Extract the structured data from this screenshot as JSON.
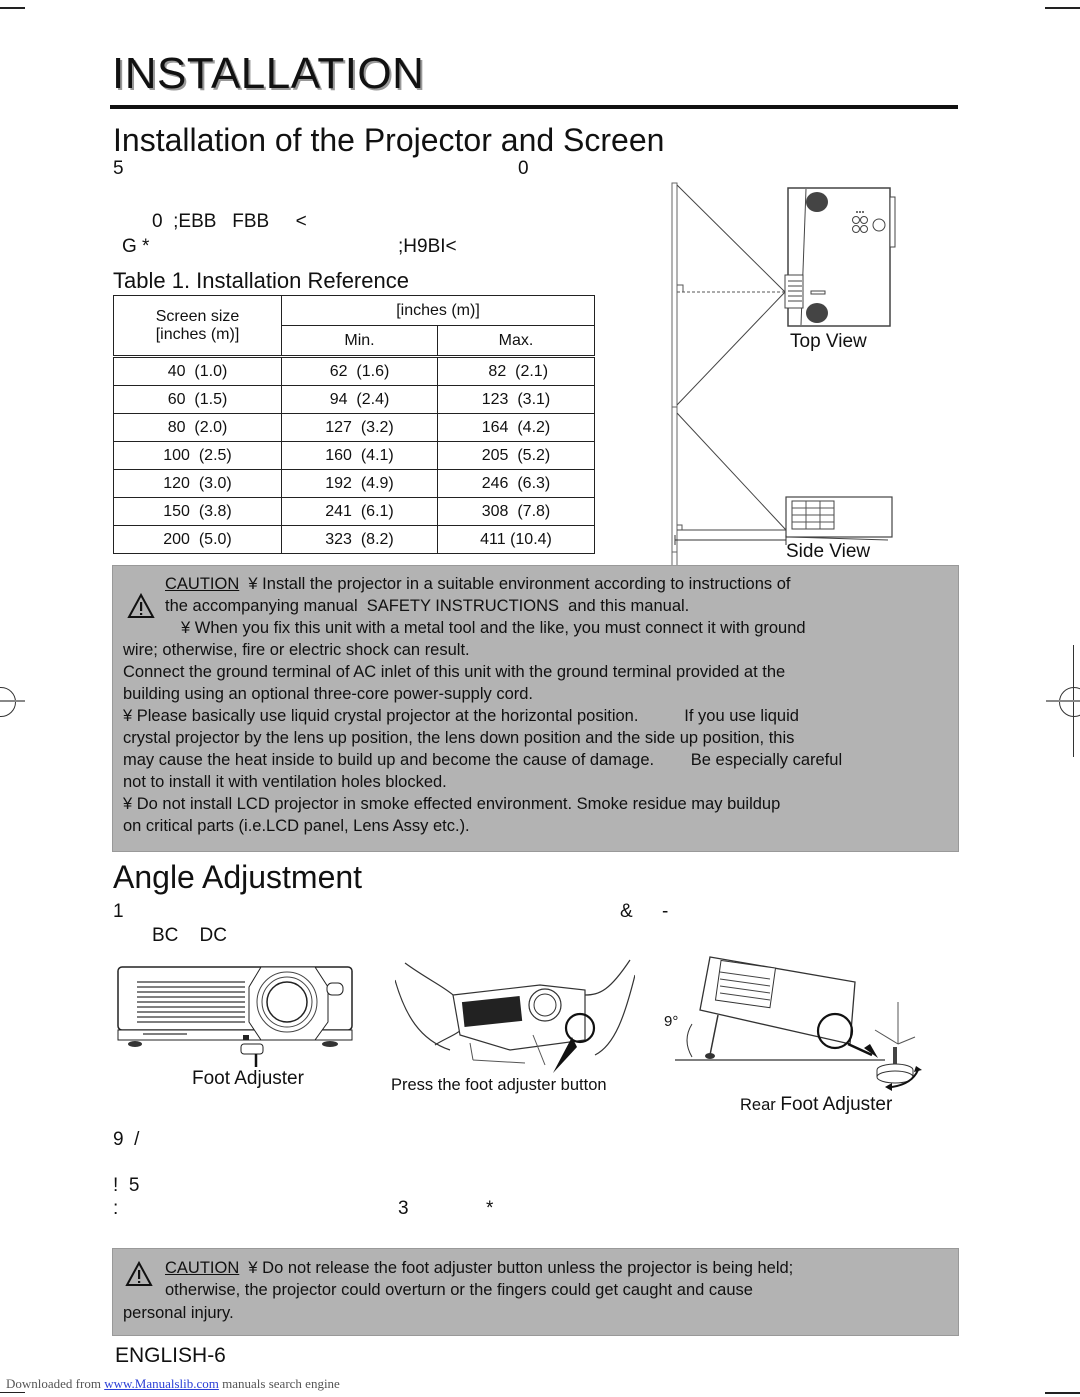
{
  "page": {
    "title": "INSTALLATION",
    "page_number": "ENGLISH-6"
  },
  "section1": {
    "heading": "Installation of the Projector and Screen",
    "garbled_lines": [
      {
        "parts": [
          "5",
          "0"
        ]
      },
      {
        "parts": [
          "0  ;EBB   FBB     <"
        ]
      },
      {
        "parts": [
          "G *",
          ";H9BI<"
        ]
      }
    ]
  },
  "table": {
    "caption": "Table 1. Installation Reference",
    "header": {
      "screen_size_line1": "Screen size",
      "screen_size_line2": "[inches (m)]",
      "distance_unit": "[inches (m)]",
      "min": "Min.",
      "max": "Max."
    },
    "rows": [
      {
        "size": "40  (1.0)",
        "min": "62  (1.6)",
        "max": " 82  (2.1)"
      },
      {
        "size": "60  (1.5)",
        "min": "94  (2.4)",
        "max": "123  (3.1)"
      },
      {
        "size": "80  (2.0)",
        "min": "127  (3.2)",
        "max": "164  (4.2)"
      },
      {
        "size": "100  (2.5)",
        "min": "160  (4.1)",
        "max": "205  (5.2)"
      },
      {
        "size": "120  (3.0)",
        "min": "192  (4.9)",
        "max": "246  (6.3)"
      },
      {
        "size": "150  (3.8)",
        "min": "241  (6.1)",
        "max": "308  (7.8)"
      },
      {
        "size": "200  (5.0)",
        "min": "323  (8.2)",
        "max": "411 (10.4)"
      }
    ]
  },
  "diagrams": {
    "top_view_label": "Top View",
    "side_view_label": "Side View"
  },
  "caution1": {
    "word": "CAUTION",
    "lines": [
      "¥ Install the projector in a suitable environment according to instructions of",
      "the accompanying manual  SAFETY INSTRUCTIONS  and this manual.",
      "¥ When you fix this unit with a metal tool and the like, you must connect it with ground",
      "wire; otherwise, fire or electric shock can result.",
      "Connect the ground terminal of AC inlet of this unit with the ground terminal provided at the",
      "building using an optional three-core power-supply cord.",
      "¥ Please basically use liquid crystal projector at the horizontal position.          If you use liquid",
      "crystal projector by the lens up position, the lens down position and the side up position, this",
      "may cause the heat inside to build up and become the cause of damage.        Be especially careful",
      "not to install it with ventilation holes blocked.",
      "¥ Do not install LCD projector in smoke effected environment. Smoke residue may buildup",
      "on critical parts (i.e.LCD panel, Lens Assy etc.)."
    ]
  },
  "section2": {
    "heading": "Angle Adjustment",
    "garbled_lines": [
      {
        "parts": [
          "1",
          "&",
          "-"
        ]
      },
      {
        "parts": [
          "BC    DC"
        ]
      },
      {
        "parts": [
          "9  /"
        ]
      },
      {
        "parts": [
          "!  5"
        ]
      },
      {
        "parts": [
          ":",
          "3",
          "*"
        ]
      }
    ]
  },
  "figures": {
    "foot_adjuster": "Foot Adjuster",
    "press_button": "Press the foot adjuster button",
    "rear_prefix": "Rear",
    "rear_foot_adjuster": "Foot Adjuster",
    "angle": "9°"
  },
  "caution2": {
    "word": "CAUTION",
    "lines": [
      "¥ Do not release the foot adjuster button unless the projector is being held;",
      "otherwise, the projector could overturn or the fingers could get caught and cause",
      "personal injury."
    ]
  },
  "download": {
    "prefix": "Downloaded from ",
    "link": "www.Manualslib.com",
    "suffix": "  manuals search engine"
  }
}
